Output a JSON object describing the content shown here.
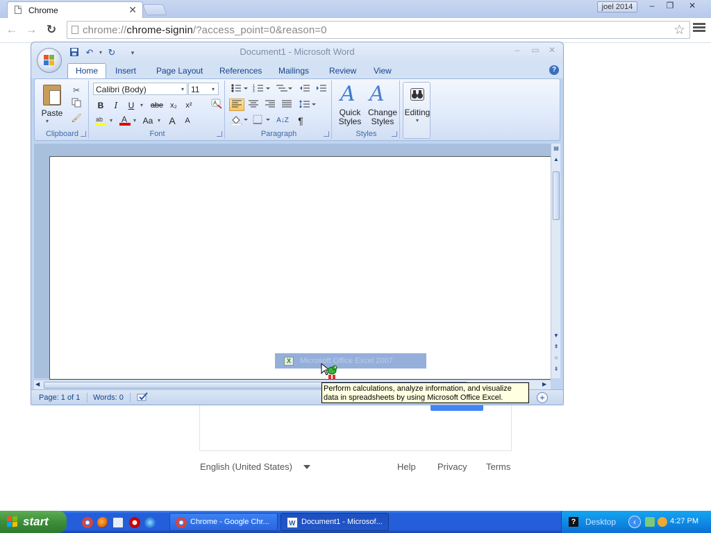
{
  "browser": {
    "tab_title": "Chrome",
    "tab_close": "✕",
    "profile_name": "joel 2014",
    "url_prefix": "chrome://",
    "url_host": "chrome-signin",
    "url_rest": "/?access_point=0&reason=0",
    "win_minimize": "–",
    "win_restore": "❐",
    "win_close": "✕",
    "back": "←",
    "forward": "→",
    "reload": "↻",
    "star": "☆"
  },
  "signin_page": {
    "language": "English (United States)",
    "links": [
      "Help",
      "Privacy",
      "Terms"
    ]
  },
  "word": {
    "title": "Document1 - Microsoft Word",
    "qat": {
      "save": "💾",
      "undo": "↶",
      "redo": "↻",
      "more": "▾"
    },
    "win_minimize": "–",
    "win_restore": "▭",
    "win_close": "✕",
    "tabs": [
      "Home",
      "Insert",
      "Page Layout",
      "References",
      "Mailings",
      "Review",
      "View"
    ],
    "active_tab": "Home",
    "help": "?",
    "ribbon": {
      "clipboard": {
        "label": "Clipboard",
        "paste": "Paste"
      },
      "font": {
        "label": "Font",
        "font_name": "Calibri (Body)",
        "font_size": "11",
        "bold": "B",
        "italic": "I",
        "underline": "U",
        "strike": "abe",
        "subscript": "x₂",
        "superscript": "x²",
        "change_case": "Aa",
        "grow": "A",
        "shrink": "A"
      },
      "paragraph": {
        "label": "Paragraph",
        "pilcrow": "¶",
        "sort": "A↓Z"
      },
      "styles": {
        "label": "Styles",
        "quick": "Quick Styles",
        "change": "Change Styles"
      },
      "editing": {
        "label": "Editing"
      }
    },
    "status": {
      "page": "Page: 1 of 1",
      "words": "Words: 0"
    }
  },
  "drag": {
    "item_label": "Microsoft Office Excel 2007",
    "tooltip": "Perform calculations, analyze information, and visualize data in spreadsheets by using Microsoft Office Excel."
  },
  "taskbar": {
    "start": "start",
    "tasks": [
      {
        "label": "Chrome - Google Chr...",
        "active": false
      },
      {
        "label": "Document1 - Microsof...",
        "active": true
      }
    ],
    "tray_help": "?",
    "desktop": "Desktop",
    "chevron": "‹",
    "time": "4:27 PM"
  }
}
